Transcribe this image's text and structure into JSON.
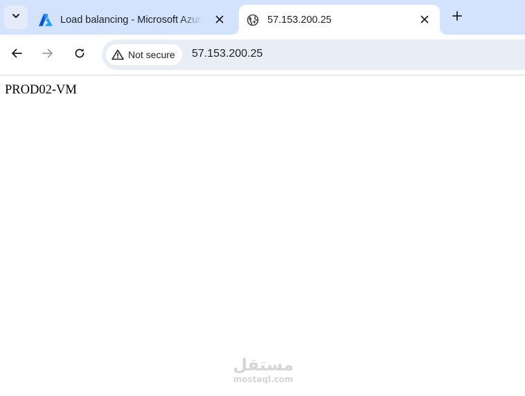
{
  "browser": {
    "tabs": [
      {
        "title": "Load balancing - Microsoft Azure",
        "icon": "azure-logo-icon",
        "active": false
      },
      {
        "title": "57.153.200.25",
        "icon": "globe-icon",
        "active": true
      }
    ],
    "new_tab_icon": "plus-icon",
    "tab_search_icon": "chevron-down-icon"
  },
  "toolbar": {
    "back_icon": "back-arrow-icon",
    "forward_icon": "forward-arrow-icon",
    "reload_icon": "reload-icon",
    "security_label": "Not secure",
    "security_icon": "warning-triangle-icon",
    "url": "57.153.200.25"
  },
  "page": {
    "body_text": "PROD02-VM"
  },
  "watermark": {
    "arabic": "مستقل",
    "latin": "mostaql.com"
  },
  "colors": {
    "tabstrip_bg": "#d3e3fd",
    "omnibox_bg": "#e9eef6",
    "azure_blue": "#0078d4"
  }
}
